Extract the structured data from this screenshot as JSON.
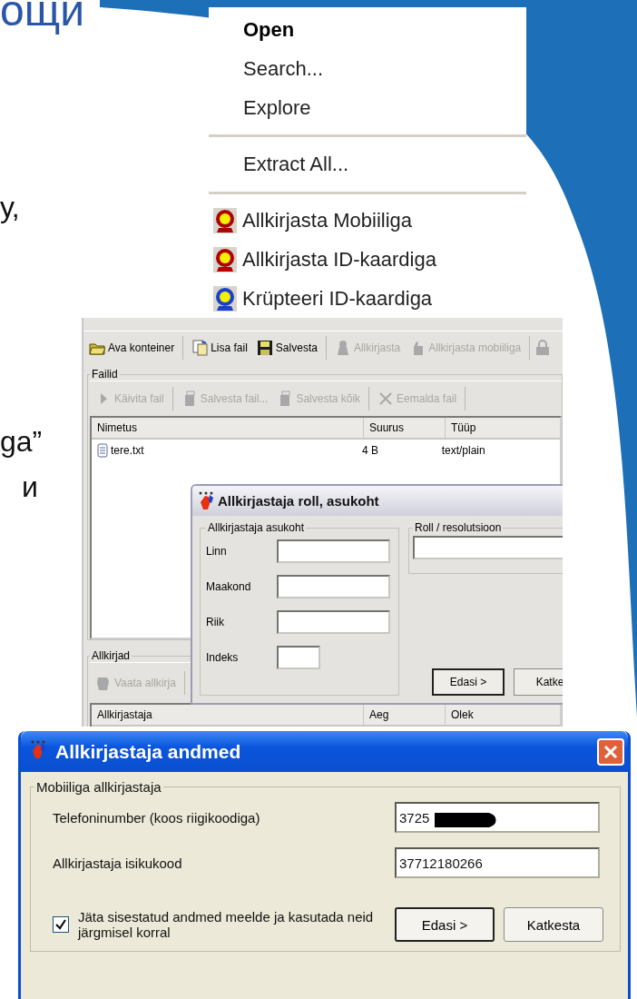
{
  "slide": {
    "title_fragment": "ощи",
    "body_fragments": [
      "у,",
      "ga”",
      "и"
    ]
  },
  "context_menu": {
    "items": [
      {
        "kind": "item",
        "label": "Open",
        "default": true
      },
      {
        "kind": "item",
        "label": "Search...",
        "default": false
      },
      {
        "kind": "item",
        "label": "Explore",
        "default": false
      },
      {
        "kind": "separator"
      },
      {
        "kind": "item",
        "label": "Extract All...",
        "default": false
      },
      {
        "kind": "separator"
      },
      {
        "kind": "icon_item",
        "label": "Allkirjasta Mobiiliga",
        "default": false,
        "color": "#b00000"
      },
      {
        "kind": "icon_item",
        "label": "Allkirjasta ID-kaardiga",
        "default": false,
        "color": "#b00000"
      },
      {
        "kind": "icon_item",
        "label": "Krüpteeri ID-kaardiga",
        "default": false,
        "color": "#1a3fd0"
      }
    ]
  },
  "main_window": {
    "toolbar": [
      {
        "label": "Ava konteiner",
        "disabled": false
      },
      {
        "label": "Lisa fail",
        "disabled": false
      },
      {
        "label": "Salvesta",
        "disabled": false
      },
      {
        "label": "Allkirjasta",
        "disabled": true
      },
      {
        "label": "Allkirjasta mobiiliga",
        "disabled": true
      }
    ],
    "files_group": {
      "title": "Failid",
      "toolbar": [
        {
          "label": "Käivita fail",
          "disabled": true
        },
        {
          "label": "Salvesta fail...",
          "disabled": true
        },
        {
          "label": "Salvesta kõik",
          "disabled": true
        },
        {
          "label": "Eemalda fail",
          "disabled": true
        }
      ],
      "columns": [
        "Nimetus",
        "Suurus",
        "Tüüp"
      ],
      "rows": [
        [
          "tere.txt",
          "4 B",
          "text/plain"
        ]
      ]
    },
    "signatures_group": {
      "title": "Allkirjad",
      "toolbar": [
        {
          "label": "Vaata allkirja",
          "disabled": true
        }
      ],
      "columns": [
        "Allkirjastaja",
        "Aeg",
        "Olek"
      ]
    }
  },
  "role_dialog": {
    "title": "Allkirjastaja roll, asukoht",
    "location_group": {
      "title": "Allkirjastaja asukoht",
      "fields": [
        {
          "label": "Linn",
          "kind": "wide"
        },
        {
          "label": "Maakond",
          "kind": "wide"
        },
        {
          "label": "Riik",
          "kind": "wide"
        },
        {
          "label": "Indeks",
          "kind": "short"
        }
      ]
    },
    "role_group": {
      "title": "Roll / resolutsioon"
    },
    "buttons": [
      {
        "label": "Edasi >",
        "default": true
      },
      {
        "label": "Katke",
        "default": false
      }
    ]
  },
  "data_dialog": {
    "title": "Allkirjastaja andmed",
    "group_title": "Mobiiliga allkirjastaja",
    "fields": [
      {
        "label": "Telefoninumber (koos riigikoodiga)",
        "value": "3725",
        "redacted": true
      },
      {
        "label": "Allkirjastaja isikukood",
        "value": "37712180266",
        "redacted": false
      }
    ],
    "remember": {
      "label": "Jäta sisestatud andmed meelde ja kasutada neid järgmisel korral",
      "checked": true
    },
    "buttons": [
      {
        "label": "Edasi >",
        "default": true
      },
      {
        "label": "Katkesta",
        "default": false
      }
    ]
  }
}
